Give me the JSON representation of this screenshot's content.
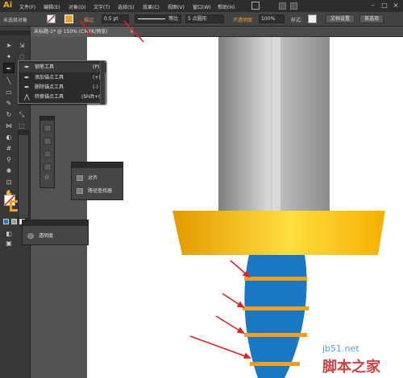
{
  "app": {
    "logo": "Ai"
  },
  "menu": [
    {
      "label": "文件(F)"
    },
    {
      "label": "编辑(E)"
    },
    {
      "label": "对象(O)"
    },
    {
      "label": "文字(T)"
    },
    {
      "label": "选择(S)"
    },
    {
      "label": "效果(C)"
    },
    {
      "label": "视图(V)"
    },
    {
      "label": "窗口(W)"
    },
    {
      "label": "帮助(H)"
    }
  ],
  "control_bar": {
    "selection_state": "未选择对象",
    "stroke_label": "描边",
    "stroke_value": "0.5 pt",
    "profile_value": "等比",
    "brush_value": "5 点圆形",
    "opacity_label": "不透明度",
    "opacity_value": "100%",
    "style_label": "样式:",
    "doc_setup_button": "文档设置",
    "prefs_button": "首选项"
  },
  "document": {
    "tab_title": "未标题-1* @ 150% (CMYK/预览)",
    "close": "×"
  },
  "pen_flyout": {
    "items": [
      {
        "label": "钢笔工具",
        "shortcut": "(P)",
        "icon": "pen-icon"
      },
      {
        "label": "添加锚点工具",
        "shortcut": "(+)",
        "icon": "add-anchor-icon"
      },
      {
        "label": "删除锚点工具",
        "shortcut": "(-)",
        "icon": "delete-anchor-icon"
      },
      {
        "label": "转换锚点工具",
        "shortcut": "(Shift+C)",
        "icon": "convert-anchor-icon"
      }
    ]
  },
  "align_panel": {
    "items": [
      {
        "label": "对齐"
      },
      {
        "label": "路径查找器"
      }
    ]
  },
  "transparency_panel": {
    "label": "透明度"
  },
  "artwork": {
    "blade_colors": [
      "#8a8a8a",
      "#cfcfcf",
      "#9a9a9a"
    ],
    "guard_colors": [
      "#e8a000",
      "#ffd23a"
    ],
    "handle_color": "#1a78c2",
    "stripe_color": "#f0a020",
    "arrow_color": "#e02020"
  },
  "watermark": {
    "site": "jb51.net",
    "name": "脚本之家"
  }
}
